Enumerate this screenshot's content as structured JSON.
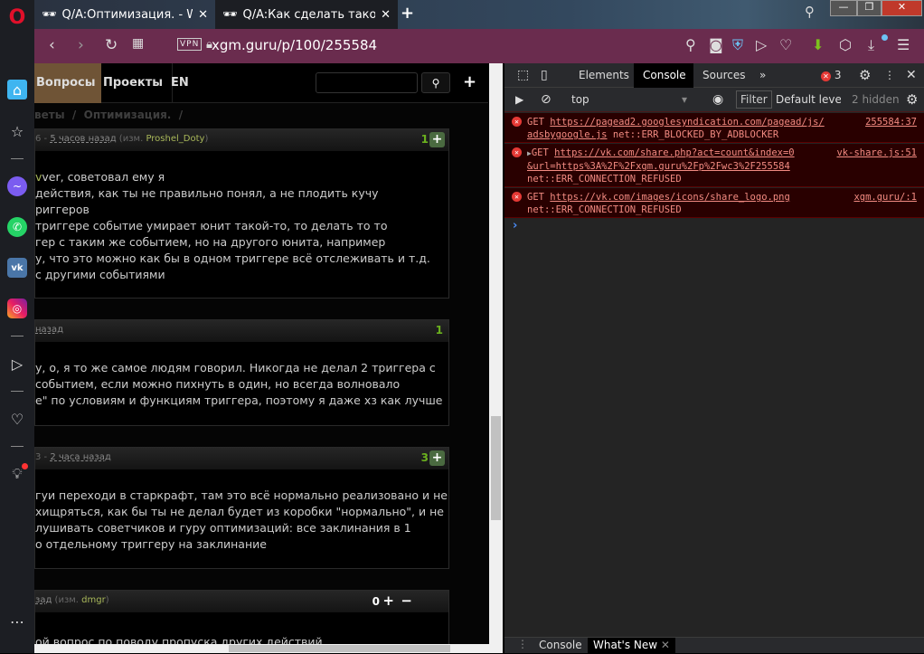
{
  "tabs": [
    {
      "title": "Q/A:Оптимизация. - WarCraft",
      "active": false
    },
    {
      "title": "Q/A:Как сделать такой триггер",
      "active": true
    }
  ],
  "address": {
    "vpn": "VPN",
    "url": "xgm.guru/p/100/255584"
  },
  "site": {
    "nav": [
      "Вопросы",
      "Проекты",
      "EN"
    ],
    "breadcrumb": [
      "веты",
      "/",
      "Оптимизация.",
      "/"
    ]
  },
  "posts": [
    {
      "meta_pre": "6 - ",
      "time": "5 часов назад",
      "edited_pre": " (изм. ",
      "editor": "Proshel_Doty",
      "edited_post": ")",
      "score": "1",
      "lines": [
        "ver, советовал ему я",
        "действия, как ты не правильно понял, а не плодить кучу",
        "риггеров",
        "триггере событие умирает юнит такой-то, то делать то то",
        "гер с таким же событием, но на другого юнита, например",
        "у, что это можно как бы в одном триггере всё отслеживать и т.д.",
        "с другими событиями"
      ]
    },
    {
      "meta_pre": "",
      "time": "назад",
      "score": "1",
      "lines": [
        "у, о, я то же самое людям говорил. Никогда не делал 2 триггера с",
        "событием, если можно пихнуть в один, но всегда волновало",
        "е\" по условиям и функциям триггера, поэтому я даже хз как лучше"
      ]
    },
    {
      "meta_pre": "3 - ",
      "time": "2 часа назад",
      "score": "3",
      "lines": [
        "гуи переходи в старкрафт, там это всё нормально реализовано и не",
        "хищряться, как бы ты не делал будет из коробки \"нормально\", и не",
        "лушивать советчиков и гуру оптимизаций: все заклинания в 1",
        "о отдельному триггеру на заклинание"
      ]
    },
    {
      "meta_pre": "",
      "time": "зад",
      "edited_pre": " (изм. ",
      "editor": "dmgr",
      "edited_post": ")",
      "score": "0",
      "lines": [
        "ой вопрос по поводу пропуска других действий"
      ]
    }
  ],
  "devtools": {
    "tabs": [
      "Elements",
      "Console",
      "Sources"
    ],
    "error_count": "3",
    "context": "top",
    "filter": "Filter",
    "levels": "Default levels",
    "hidden": "2 hidden",
    "messages": [
      {
        "method": "GET",
        "url": "https://pagead2.googlesyndication.com/pagead/js/",
        "url2": "adsbygoogle.js",
        "error": "net::ERR_BLOCKED_BY_ADBLOCKER",
        "source": "255584:37"
      },
      {
        "method": "GET",
        "url": "https://vk.com/share.php?act=count&index=0",
        "url2": "&url=https%3A%2F%2Fxgm.guru%2Fp%2Fwc3%2F255584",
        "error": "net::ERR_CONNECTION_REFUSED",
        "source": "vk-share.js:51"
      },
      {
        "method": "GET",
        "url": "https://vk.com/images/icons/share_logo.png",
        "error": "net::ERR_CONNECTION_REFUSED",
        "source": "xgm.guru/:1"
      }
    ],
    "prompt": "›",
    "drawer_tabs": [
      "Console",
      "What's New"
    ]
  },
  "colors": {
    "address_bar": "#6a2c4e",
    "active_nav": "#6f5436",
    "score": "#6ab01e"
  }
}
